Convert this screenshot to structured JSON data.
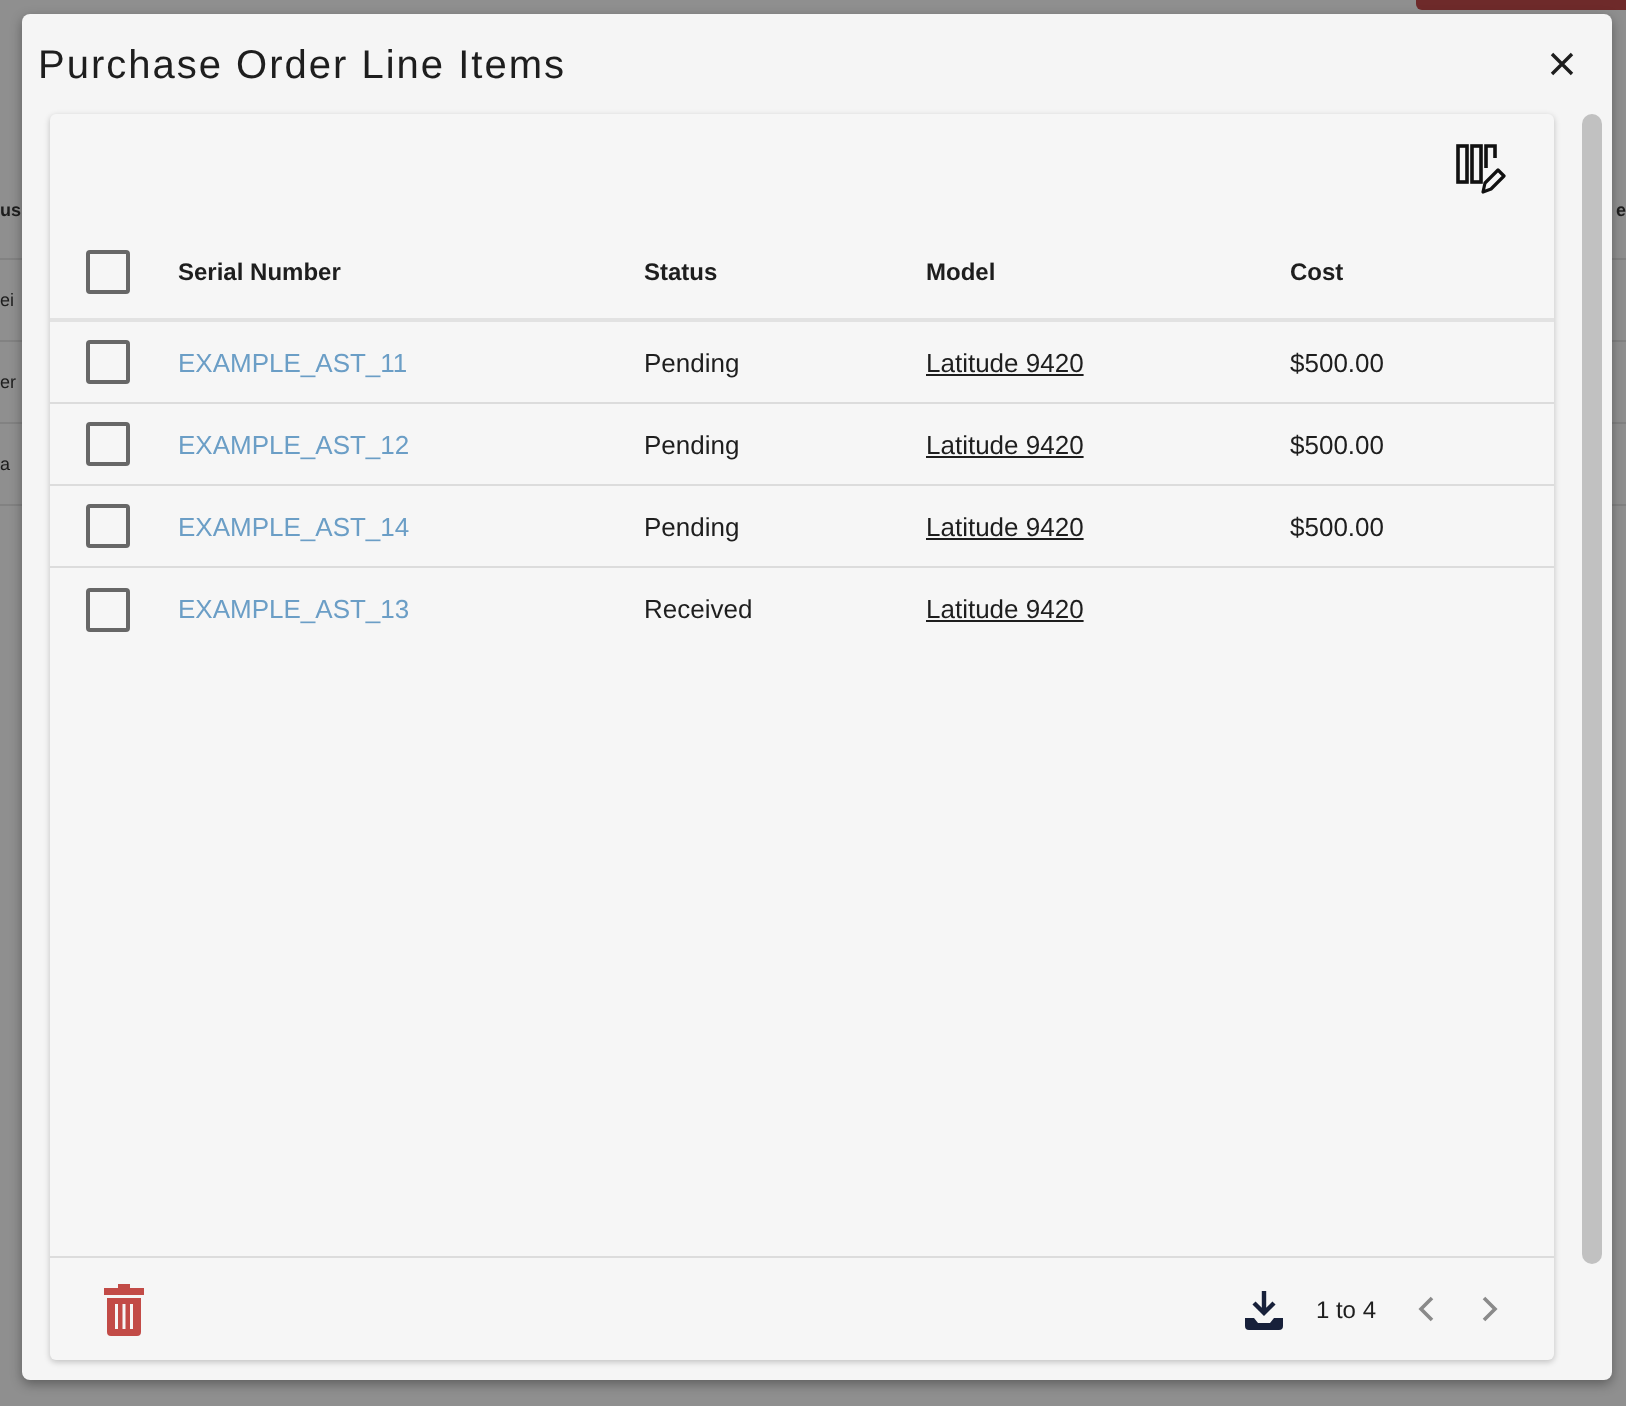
{
  "background_page": {
    "button": {
      "visible": true
    },
    "rows": [
      {
        "kind": "header",
        "left_fragment": "us",
        "right_fragment": "e"
      },
      {
        "kind": "row",
        "left_fragment": "ei"
      },
      {
        "kind": "row",
        "left_fragment": "er"
      },
      {
        "kind": "row",
        "left_fragment": "a"
      }
    ]
  },
  "dialog": {
    "title": "Purchase Order Line Items"
  },
  "table": {
    "columns": [
      "Serial Number",
      "Status",
      "Model",
      "Cost"
    ],
    "select_all": {
      "checked": false
    },
    "rows": [
      {
        "checked": false,
        "serial_number": "EXAMPLE_AST_11",
        "status": "Pending",
        "model": "Latitude 9420",
        "cost": "$500.00"
      },
      {
        "checked": false,
        "serial_number": "EXAMPLE_AST_12",
        "status": "Pending",
        "model": "Latitude 9420",
        "cost": "$500.00"
      },
      {
        "checked": false,
        "serial_number": "EXAMPLE_AST_14",
        "status": "Pending",
        "model": "Latitude 9420",
        "cost": "$500.00"
      },
      {
        "checked": false,
        "serial_number": "EXAMPLE_AST_13",
        "status": "Received",
        "model": "Latitude 9420"
      }
    ]
  },
  "footer": {
    "range": "1 to 4",
    "previous": {
      "disabled": true
    },
    "next": {
      "disabled": true
    }
  }
}
